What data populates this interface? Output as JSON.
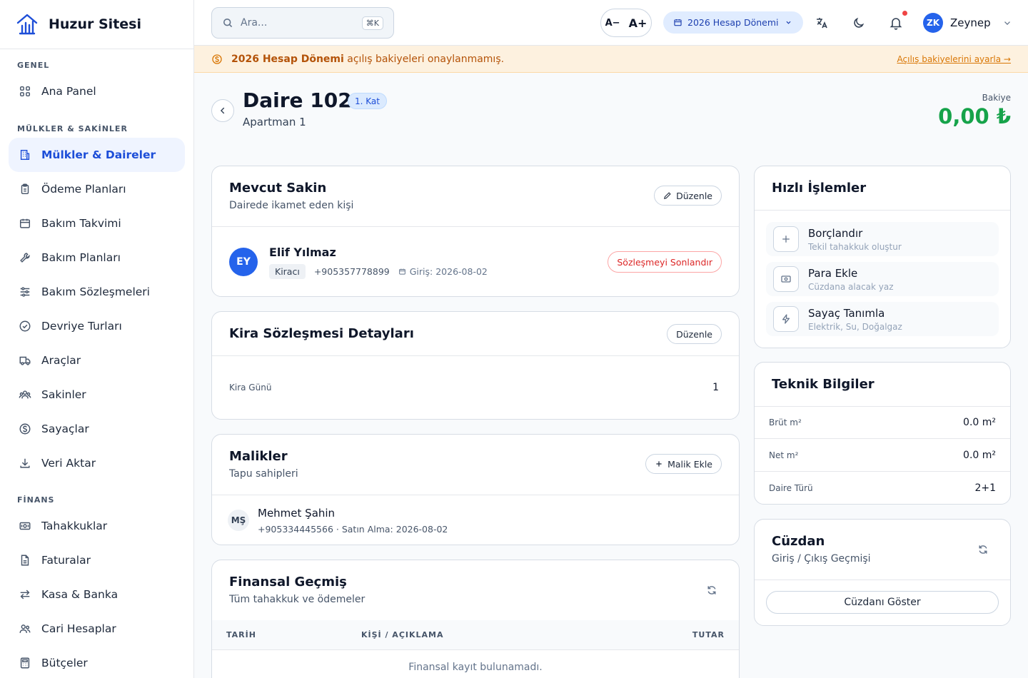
{
  "app": {
    "name": "Huzur Sitesi"
  },
  "sidebar": {
    "sections": [
      {
        "label": "GENEL",
        "items": [
          {
            "label": "Ana Panel",
            "icon": "grid-icon"
          }
        ]
      },
      {
        "label": "MÜLKLER & SAKİNLER",
        "items": [
          {
            "label": "Mülkler & Daireler",
            "icon": "building-icon",
            "active": true
          },
          {
            "label": "Ödeme Planları",
            "icon": "clipboard-icon"
          },
          {
            "label": "Bakım Takvimi",
            "icon": "calendar-icon"
          },
          {
            "label": "Bakım Planları",
            "icon": "wrench-icon"
          },
          {
            "label": "Bakım Sözleşmeleri",
            "icon": "sliders-icon"
          },
          {
            "label": "Devriye Turları",
            "icon": "check-circle-icon"
          },
          {
            "label": "Araçlar",
            "icon": "truck-icon"
          },
          {
            "label": "Sakinler",
            "icon": "users-icon"
          },
          {
            "label": "Sayaçlar",
            "icon": "dollar-circle-icon"
          },
          {
            "label": "Veri Aktar",
            "icon": "download-icon"
          }
        ]
      },
      {
        "label": "FİNANS",
        "items": [
          {
            "label": "Tahakkuklar",
            "icon": "banknote-icon"
          },
          {
            "label": "Faturalar",
            "icon": "file-icon"
          },
          {
            "label": "Kasa & Banka",
            "icon": "arrows-icon"
          },
          {
            "label": "Cari Hesaplar",
            "icon": "user-group-icon"
          },
          {
            "label": "Bütçeler",
            "icon": "calculator-icon"
          }
        ]
      }
    ]
  },
  "topbar": {
    "search_placeholder": "Ara...",
    "search_shortcut": "⌘K",
    "font_decrease": "A−",
    "font_increase": "A+",
    "period": "2026 Hesap Dönemi",
    "user": {
      "initials": "ZK",
      "name": "Zeynep"
    }
  },
  "banner": {
    "strong": "2026 Hesap Dönemi",
    "text": " açılış bakiyeleri onaylanmamış.",
    "link": "Açılış bakiyelerini ayarla →"
  },
  "header": {
    "title": "Daire 102",
    "floor_badge": "1. Kat",
    "subtitle": "Apartman 1",
    "balance_label": "Bakiye",
    "balance_value": "0,00 ₺"
  },
  "resident_card": {
    "title": "Mevcut Sakin",
    "subtitle": "Dairede ikamet eden kişi",
    "edit_label": "Düzenle",
    "resident": {
      "initials": "EY",
      "name": "Elif Yılmaz",
      "role": "Kiracı",
      "phone": "+905357778899",
      "entry": "Giriş: 2026-08-02"
    },
    "end_contract_label": "Sözleşmeyi Sonlandır"
  },
  "lease_card": {
    "title": "Kira Sözleşmesi Detayları",
    "edit_label": "Düzenle",
    "rent_day_label": "Kira Günü",
    "rent_day_value": "1"
  },
  "owners_card": {
    "title": "Malikler",
    "subtitle": "Tapu sahipleri",
    "add_label": "Malik Ekle",
    "owner": {
      "initials": "MŞ",
      "name": "Mehmet Şahin",
      "meta": "+905334445566 · Satın Alma: 2026-08-02"
    }
  },
  "finance_card": {
    "title": "Finansal Geçmiş",
    "subtitle": "Tüm tahakkuk ve ödemeler",
    "columns": [
      "TARİH",
      "KİŞİ / AÇIKLAMA",
      "TUTAR"
    ],
    "empty": "Finansal kayıt bulunamadı."
  },
  "quick_actions": {
    "title": "Hızlı İşlemler",
    "items": [
      {
        "title": "Borçlandır",
        "subtitle": "Tekil tahakkuk oluştur",
        "icon": "plus-icon"
      },
      {
        "title": "Para Ekle",
        "subtitle": "Cüzdana alacak yaz",
        "icon": "banknote-icon"
      },
      {
        "title": "Sayaç Tanımla",
        "subtitle": "Elektrik, Su, Doğalgaz",
        "icon": "bolt-icon"
      }
    ]
  },
  "tech_info": {
    "title": "Teknik Bilgiler",
    "rows": [
      {
        "label": "Brüt m²",
        "value": "0.0 m²"
      },
      {
        "label": "Net m²",
        "value": "0.0 m²"
      },
      {
        "label": "Daire Türü",
        "value": "2+1"
      }
    ]
  },
  "wallet": {
    "title": "Cüzdan",
    "subtitle": "Giriş / Çıkış Geçmişi",
    "button": "Cüzdanı Göster"
  },
  "colors": {
    "primary": "#2563eb",
    "success": "#16a34a",
    "warning_bg": "#fdf1df",
    "warning_text": "#b45309",
    "danger": "#dc2626"
  }
}
